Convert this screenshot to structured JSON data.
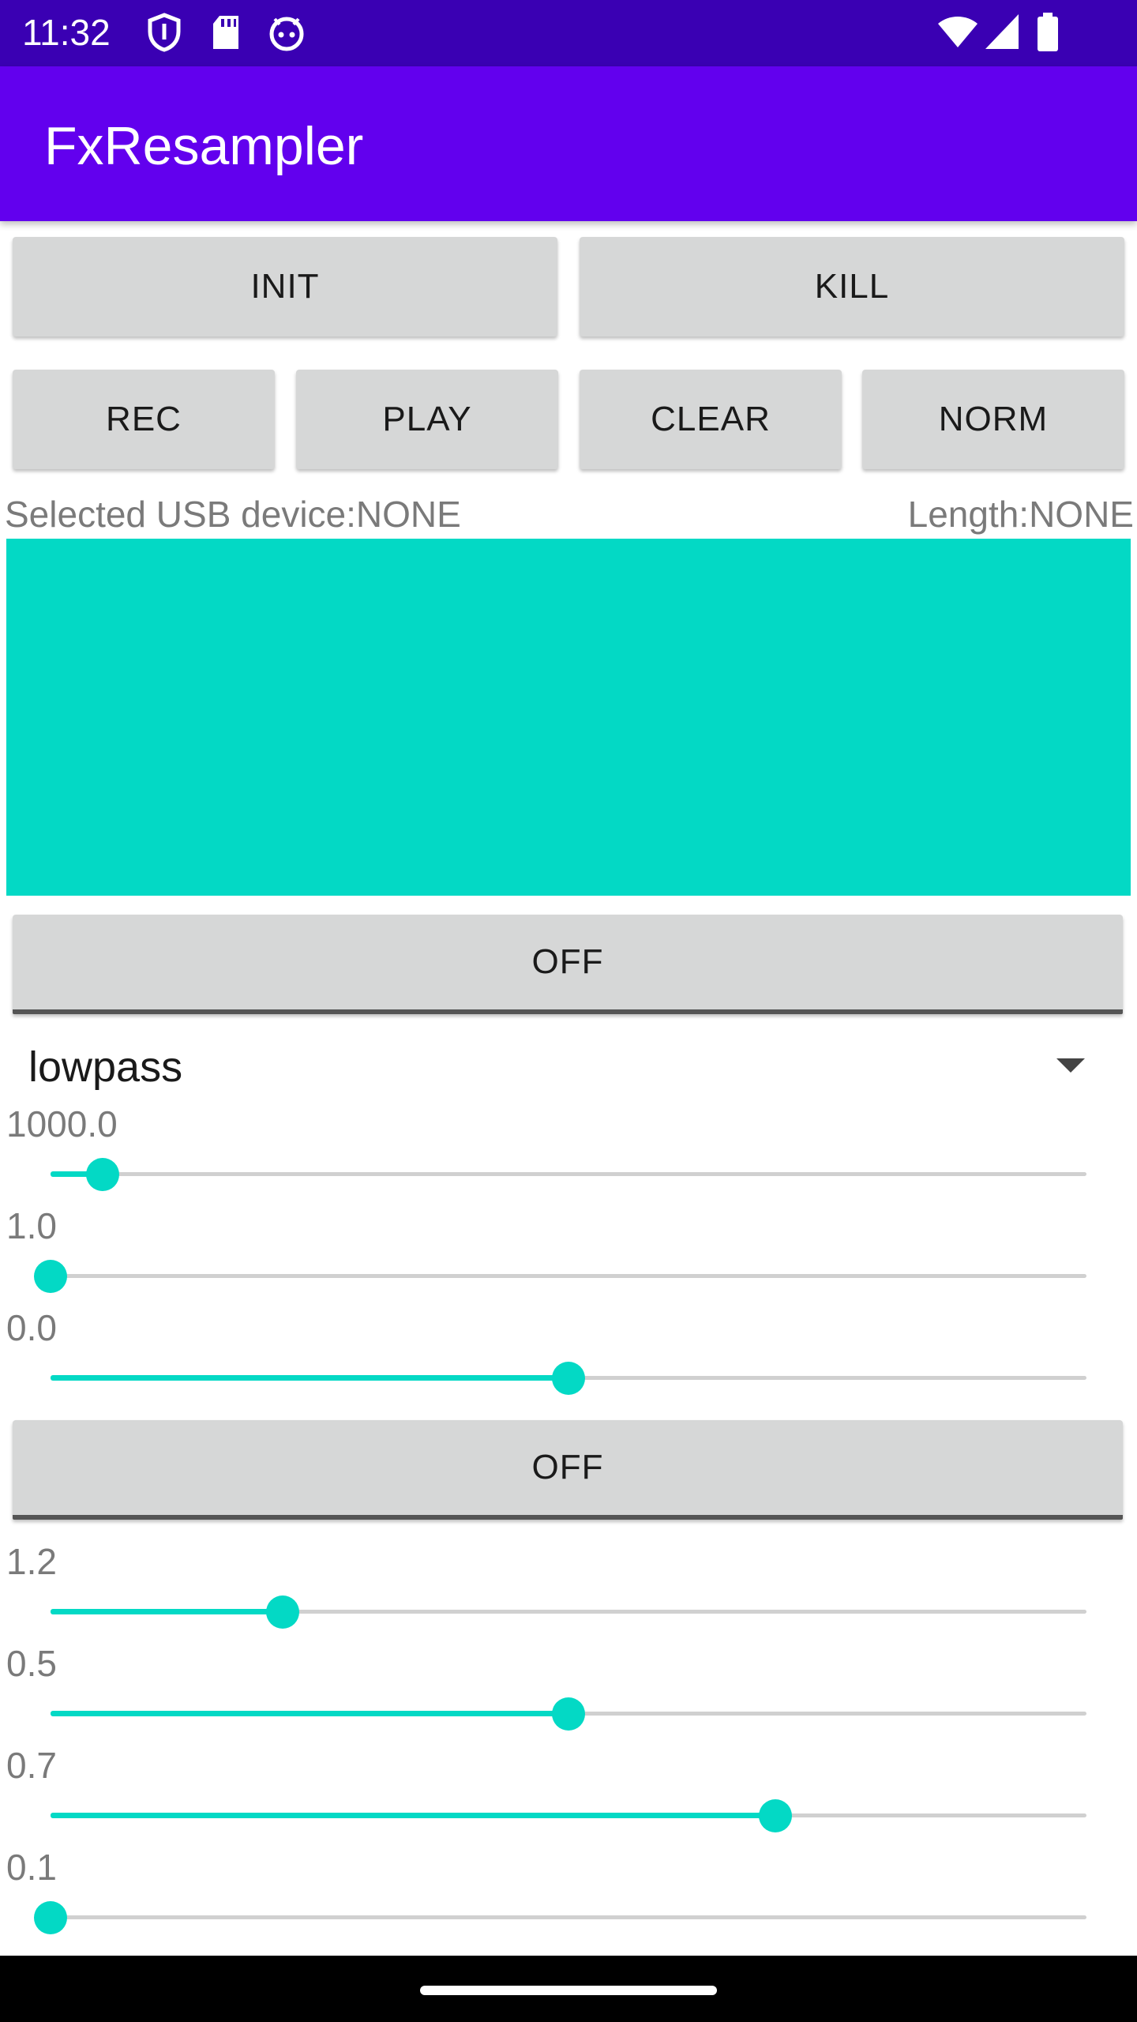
{
  "status_bar": {
    "time": "11:32",
    "left_icons": [
      "shield-icon",
      "sd-card-icon",
      "android-debug-icon"
    ],
    "right_icons": [
      "wifi-icon",
      "cell-signal-icon",
      "battery-icon"
    ]
  },
  "app_bar": {
    "title": "FxResampler",
    "color": "#6200ee"
  },
  "buttons": {
    "init": "INIT",
    "kill": "KILL",
    "rec": "REC",
    "play": "PLAY",
    "clear": "CLEAR",
    "norm": "NORM"
  },
  "info": {
    "selected_device": "Selected USB device:NONE",
    "length": "Length:NONE"
  },
  "waveform_color": "#03d9c5",
  "filter_section": {
    "toggle_label": "OFF",
    "filter_type": "lowpass",
    "sliders": [
      {
        "label": "1000.0",
        "level": 0.05
      },
      {
        "label": "1.0",
        "level": 0.0
      },
      {
        "label": "0.0",
        "level": 0.5
      }
    ]
  },
  "second_section": {
    "toggle_label": "OFF",
    "sliders": [
      {
        "label": "1.2",
        "level": 0.224
      },
      {
        "label": "0.5",
        "level": 0.5
      },
      {
        "label": "0.7",
        "level": 0.7
      },
      {
        "label": "0.1",
        "level": 0.0
      }
    ]
  }
}
